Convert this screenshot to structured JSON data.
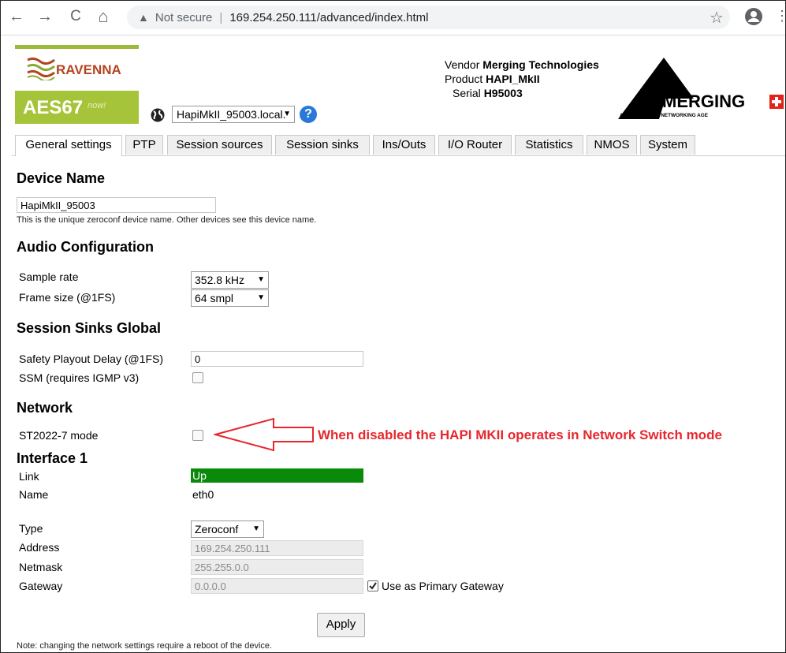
{
  "browser": {
    "security_label": "Not secure",
    "url": "169.254.250.111/advanced/index.html",
    "back_icon": "←",
    "forward_icon": "→",
    "reload_icon": "C",
    "home_icon": "⌂",
    "star_icon": "☆",
    "menu_icon": "⋮"
  },
  "header": {
    "ravenna_label": "RAVENNA",
    "aes_label": "AES67",
    "aes_now": "now!",
    "host_selected": "HapiMkII_95003.local.",
    "help_glyph": "?",
    "vendor_label": "Vendor",
    "vendor_value": "Merging Technologies",
    "product_label": "Product",
    "product_value": "HAPI_MkII",
    "serial_label": "Serial",
    "serial_value": "H95003",
    "merging_logo_text": "MERGING",
    "merging_tagline": "AUDIO FOR THE NETWORKING AGE",
    "accent_green": "#a5c43a",
    "merging_red": "#e2231a"
  },
  "tabs": [
    {
      "label": "General settings",
      "active": true
    },
    {
      "label": "PTP"
    },
    {
      "label": "Session sources"
    },
    {
      "label": "Session sinks"
    },
    {
      "label": "Ins/Outs"
    },
    {
      "label": "I/O Router"
    },
    {
      "label": "Statistics"
    },
    {
      "label": "NMOS"
    },
    {
      "label": "System"
    }
  ],
  "device_name": {
    "heading": "Device Name",
    "value": "HapiMkII_95003",
    "help": "This is the unique zeroconf device name. Other devices see this device name."
  },
  "audio": {
    "heading": "Audio Configuration",
    "sample_rate_label": "Sample rate",
    "sample_rate_value": "352.8 kHz",
    "frame_size_label": "Frame size (@1FS)",
    "frame_size_value": "64 smpl"
  },
  "sinks_global": {
    "heading": "Session Sinks Global",
    "safety_label": "Safety Playout Delay (@1FS)",
    "safety_value": "0",
    "ssm_label": "SSM (requires IGMP v3)",
    "ssm_checked": false
  },
  "network": {
    "heading": "Network",
    "st2022_label": "ST2022-7 mode",
    "st2022_checked": false,
    "annotation": "When disabled the HAPI MKII operates in Network Switch mode",
    "interface_heading": "Interface 1",
    "link_label": "Link",
    "link_value": "Up",
    "name_label": "Name",
    "name_value": "eth0",
    "type_label": "Type",
    "type_value": "Zeroconf",
    "address_label": "Address",
    "address_value": "169.254.250.111",
    "netmask_label": "Netmask",
    "netmask_value": "255.255.0.0",
    "gateway_label": "Gateway",
    "gateway_value": "0.0.0.0",
    "primary_gateway_label": "Use as Primary Gateway",
    "primary_gateway_checked": true,
    "apply_label": "Apply",
    "note": "Note: changing the network settings require a reboot of the device."
  }
}
